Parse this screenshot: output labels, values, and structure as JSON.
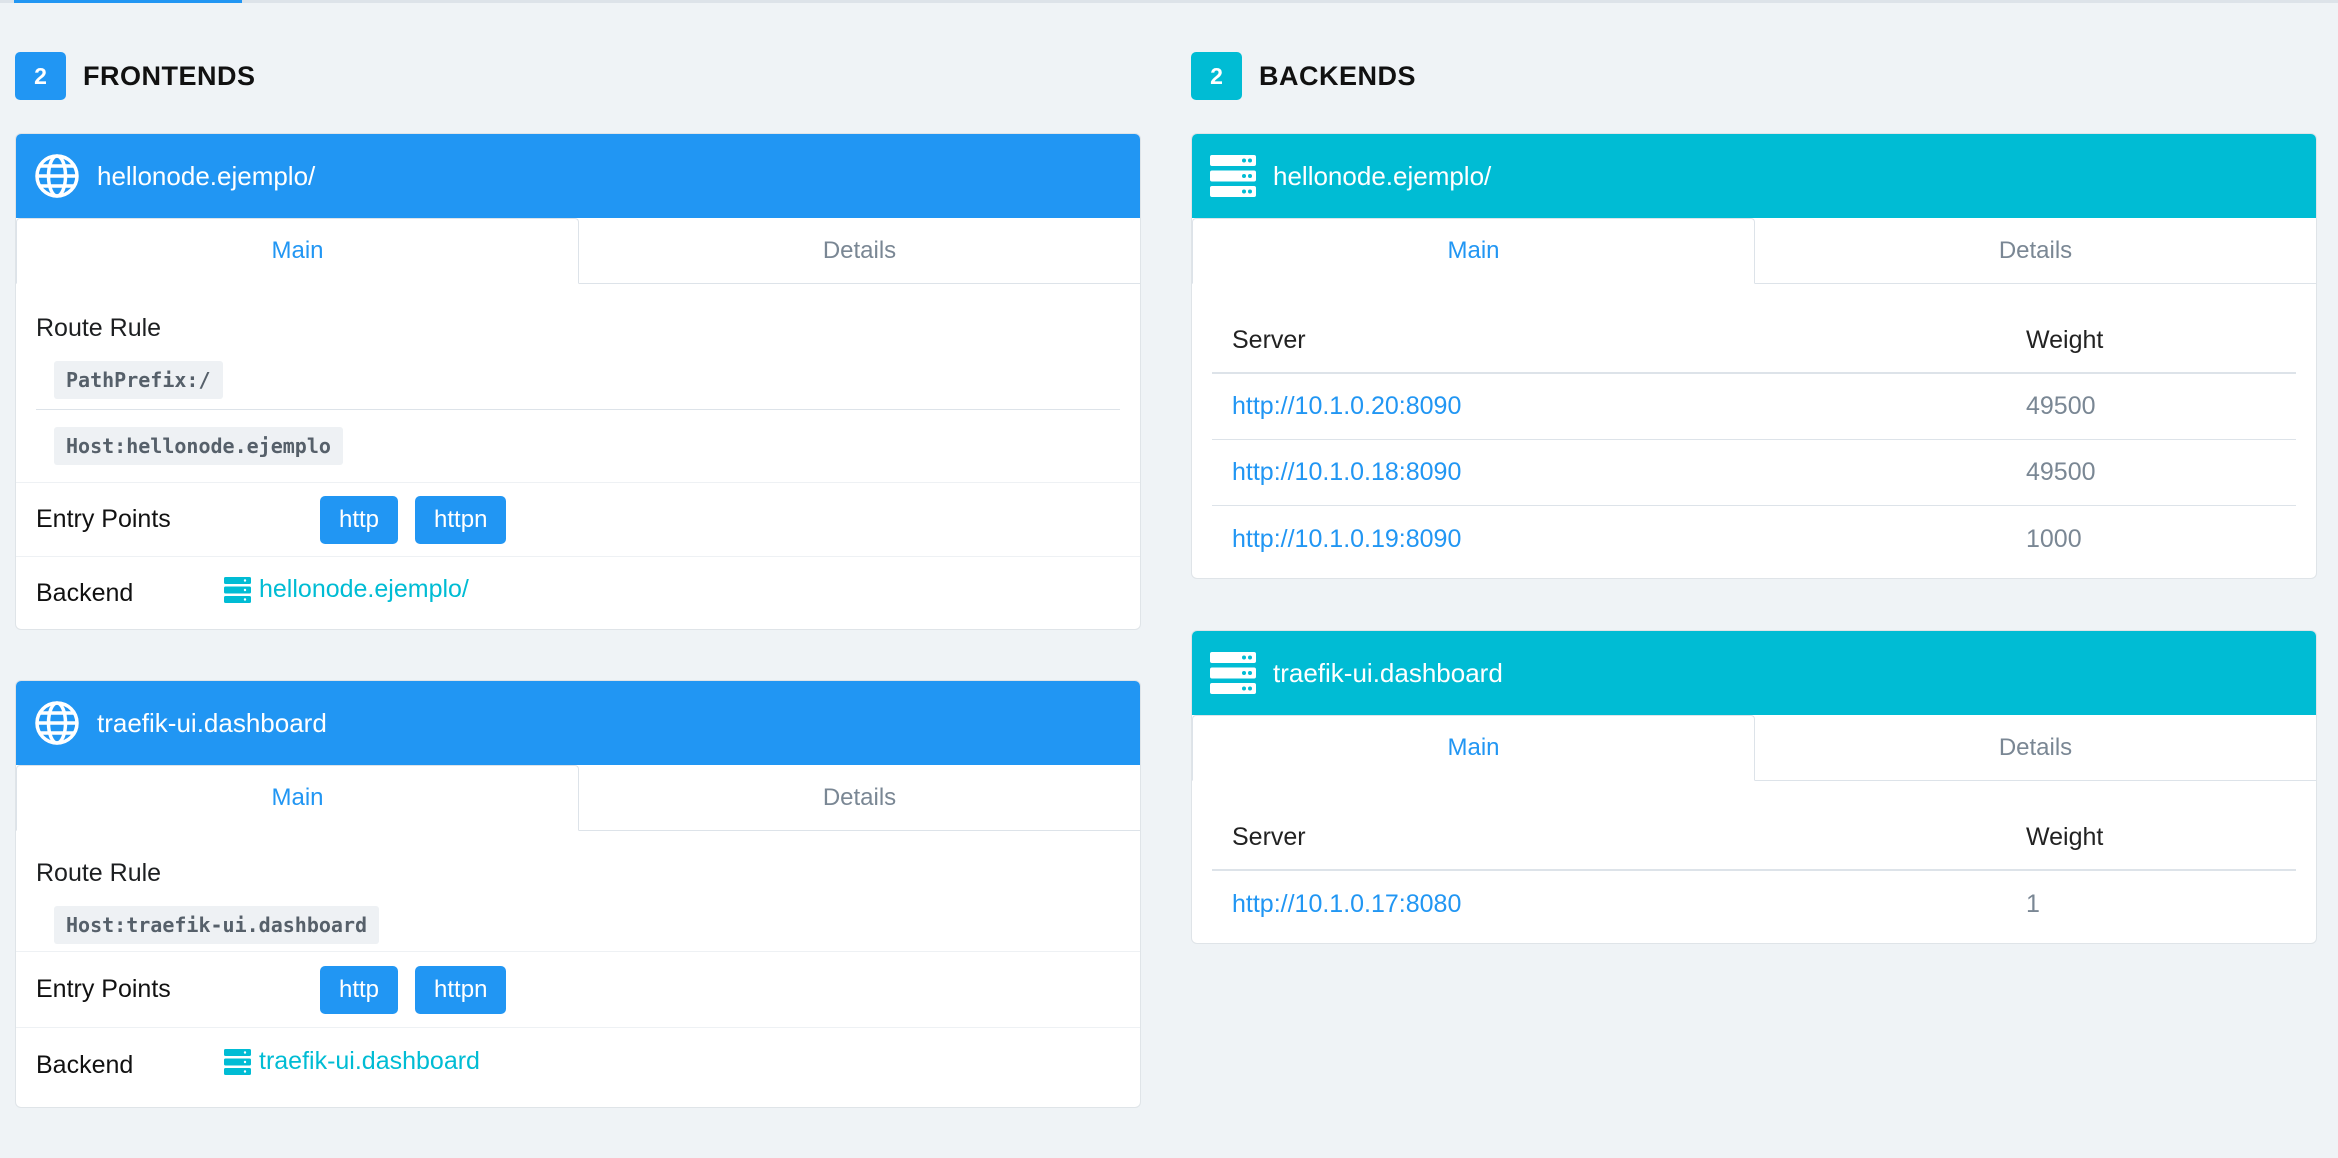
{
  "frontends": {
    "count": "2",
    "title": "FRONTENDS",
    "items": [
      {
        "name": "hellonode.ejemplo/",
        "tabs": {
          "main": "Main",
          "details": "Details"
        },
        "route_rule_label": "Route Rule",
        "rules": [
          "PathPrefix:/",
          "Host:hellonode.ejemplo"
        ],
        "entry_points_label": "Entry Points",
        "entry_points": [
          "http",
          "httpn"
        ],
        "backend_label": "Backend",
        "backend": "hellonode.ejemplo/"
      },
      {
        "name": "traefik-ui.dashboard",
        "tabs": {
          "main": "Main",
          "details": "Details"
        },
        "route_rule_label": "Route Rule",
        "rules": [
          "Host:traefik-ui.dashboard"
        ],
        "entry_points_label": "Entry Points",
        "entry_points": [
          "http",
          "httpn"
        ],
        "backend_label": "Backend",
        "backend": "traefik-ui.dashboard"
      }
    ]
  },
  "backends": {
    "count": "2",
    "title": "BACKENDS",
    "items": [
      {
        "name": "hellonode.ejemplo/",
        "tabs": {
          "main": "Main",
          "details": "Details"
        },
        "server_header": "Server",
        "weight_header": "Weight",
        "servers": [
          {
            "url": "http://10.1.0.20:8090",
            "weight": "49500"
          },
          {
            "url": "http://10.1.0.18:8090",
            "weight": "49500"
          },
          {
            "url": "http://10.1.0.19:8090",
            "weight": "1000"
          }
        ]
      },
      {
        "name": "traefik-ui.dashboard",
        "tabs": {
          "main": "Main",
          "details": "Details"
        },
        "server_header": "Server",
        "weight_header": "Weight",
        "servers": [
          {
            "url": "http://10.1.0.17:8080",
            "weight": "1"
          }
        ]
      }
    ]
  },
  "colors": {
    "frontend_accent": "#2196f3",
    "backend_accent": "#00bcd4",
    "background": "#eff3f6"
  },
  "icons": {
    "frontend": "globe-icon",
    "backend": "server-stack-icon"
  }
}
